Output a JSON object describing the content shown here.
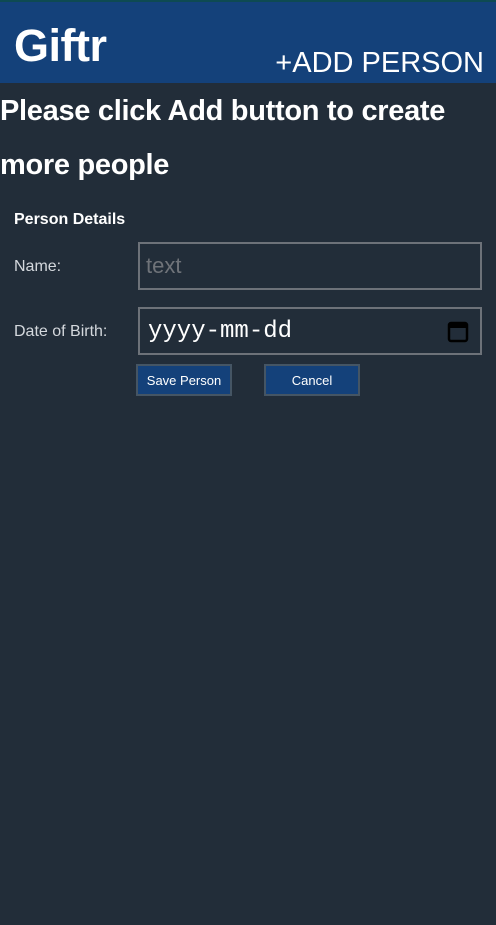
{
  "header": {
    "app_title": "Giftr",
    "add_person_label": "+ADD PERSON"
  },
  "main": {
    "message": "Please click Add button to create more people"
  },
  "form": {
    "heading": "Person Details",
    "name_label": "Name:",
    "name_placeholder": "text",
    "name_value": "",
    "dob_label": "Date of Birth:",
    "dob_placeholder": "yyyy-mm-dd",
    "save_label": "Save Person",
    "cancel_label": "Cancel"
  },
  "icons": {
    "calendar": "calendar-icon"
  },
  "colors": {
    "background": "#222d39",
    "header": "#14417a",
    "button": "#14417a"
  }
}
